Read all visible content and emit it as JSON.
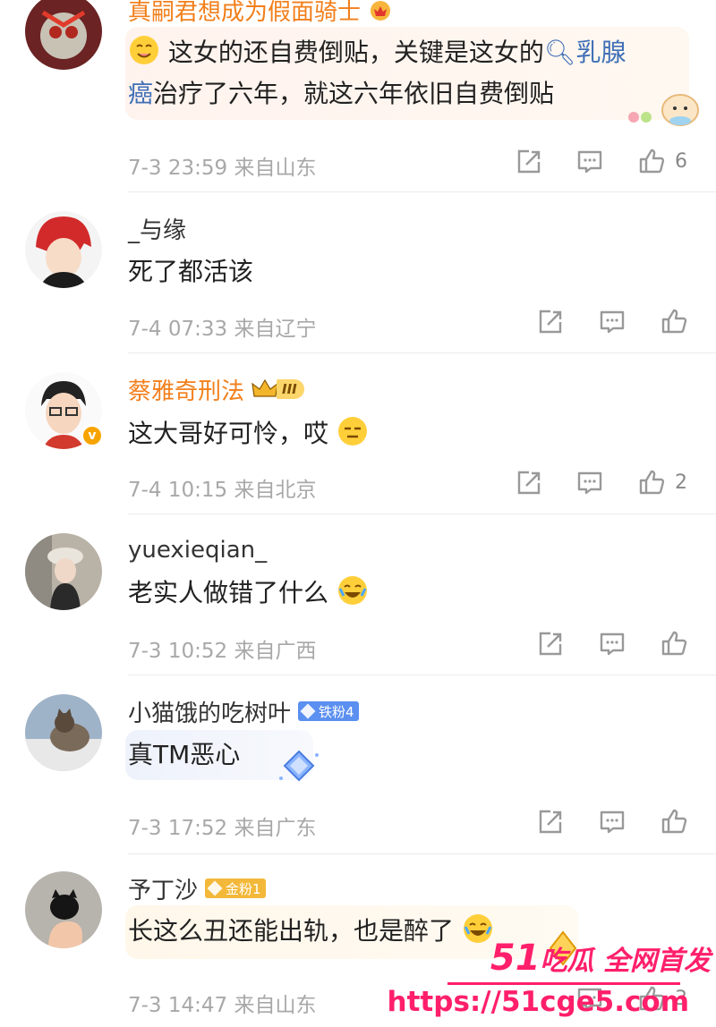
{
  "comments": [
    {
      "user": "真嗣君想成为假面骑士",
      "text_line1_a": "这女的还自费倒贴，关键是这女的",
      "text_line1_link": "乳腺",
      "text_line2_link": "癌",
      "text_line2_b": "治疗了六年，就这六年依旧自费倒贴",
      "time": "7-3 23:59",
      "location": "来自山东",
      "likes": "6"
    },
    {
      "user": "_与缘",
      "text": "死了都活该",
      "time": "7-4 07:33",
      "location": "来自辽宁",
      "likes": ""
    },
    {
      "user": "蔡雅奇刑法",
      "vip_level": "III",
      "text": "这大哥好可怜，哎",
      "time": "7-4 10:15",
      "location": "来自北京",
      "likes": "2"
    },
    {
      "user": "yuexieqian_",
      "text": "老实人做错了什么",
      "time": "7-3 10:52",
      "location": "来自广西",
      "likes": ""
    },
    {
      "user": "小猫饿的吃树叶",
      "fan_badge": "铁粉4",
      "text": "真TM恶心",
      "time": "7-3 17:52",
      "location": "来自广东",
      "likes": ""
    },
    {
      "user": "予丁沙",
      "fan_badge": "金粉1",
      "text": "长这么丑还能出轨，也是醉了",
      "time": "7-3 14:47",
      "location": "来自山东",
      "likes": "3"
    }
  ],
  "watermark": {
    "line1_num": "51",
    "line1_text": "吃瓜 全网首发",
    "url": "https://51cge5.com"
  },
  "colors": {
    "accent_orange": "#f27f1b",
    "link_blue": "#3f6fb6",
    "meta_gray": "#a8a8a8",
    "watermark_pink": "#ff1f6b"
  }
}
